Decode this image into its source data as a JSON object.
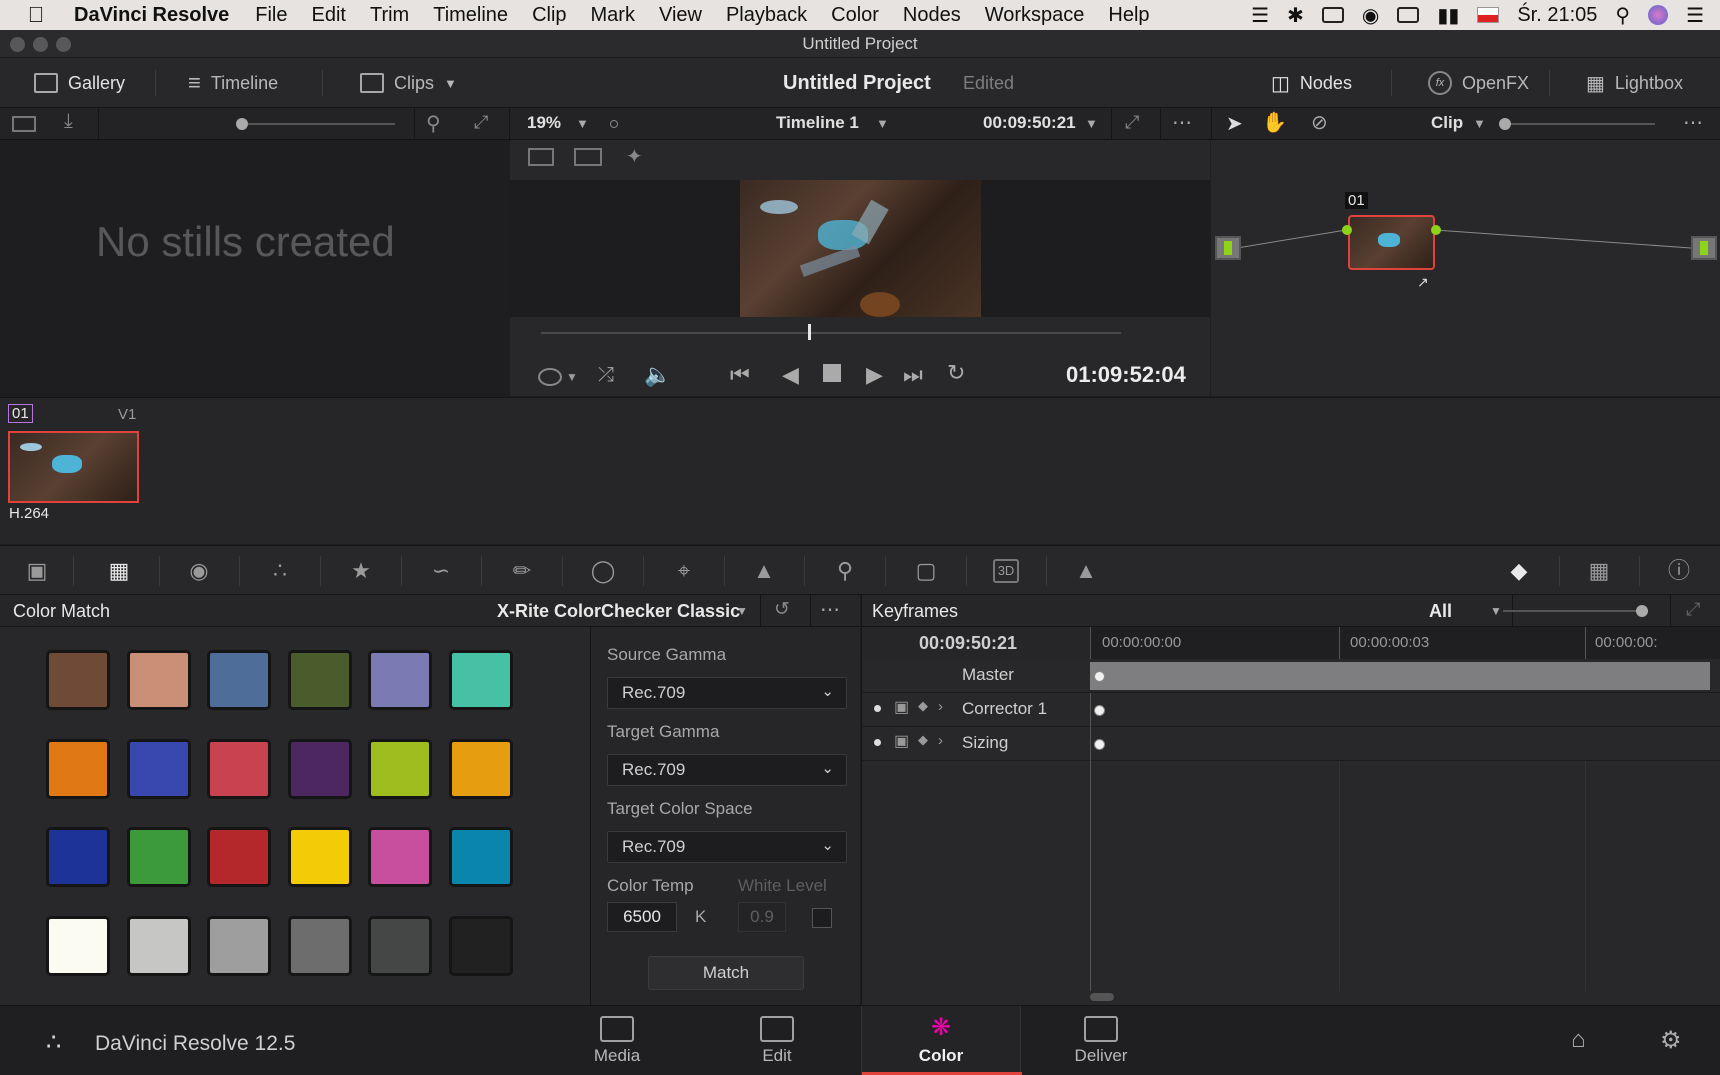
{
  "menubar": {
    "app_name": "DaVinci Resolve",
    "items": [
      "File",
      "Edit",
      "Trim",
      "Timeline",
      "Clip",
      "Mark",
      "View",
      "Playback",
      "Color",
      "Nodes",
      "Workspace",
      "Help"
    ],
    "clock": "Śr. 21:05"
  },
  "window": {
    "title": "Untitled Project"
  },
  "toolbar": {
    "gallery": "Gallery",
    "timeline": "Timeline",
    "clips": "Clips",
    "project_title": "Untitled Project",
    "project_status": "Edited",
    "nodes": "Nodes",
    "openfx": "OpenFX",
    "lightbox": "Lightbox"
  },
  "viewer_bar": {
    "zoom": "19%",
    "timeline_name": "Timeline 1",
    "timecode": "00:09:50:21",
    "mode": "Clip"
  },
  "gallery": {
    "empty_text": "No stills created"
  },
  "viewer": {
    "playhead_timecode": "01:09:52:04",
    "scrub_progress": 0.46
  },
  "nodes": {
    "node_label": "01"
  },
  "clip": {
    "number": "01",
    "track": "V1",
    "codec": "H.264"
  },
  "color_match": {
    "title": "Color Match",
    "chart": "X-Rite ColorChecker Classic",
    "swatches": [
      "#6f4a36",
      "#c98f77",
      "#4f6d99",
      "#4a5c2c",
      "#7b7ab3",
      "#47c1a5",
      "#e07913",
      "#3848ae",
      "#c8434f",
      "#4d275f",
      "#9fbd1f",
      "#e69e10",
      "#1e3398",
      "#3c9a3b",
      "#b4272b",
      "#f3cc07",
      "#c84f9d",
      "#0a86ad",
      "#fbfbf2",
      "#c6c7c4",
      "#9d9e9d",
      "#6c6d6c",
      "#454646",
      "#212121"
    ],
    "source_gamma_label": "Source Gamma",
    "source_gamma": "Rec.709",
    "target_gamma_label": "Target Gamma",
    "target_gamma": "Rec.709",
    "target_space_label": "Target Color Space",
    "target_space": "Rec.709",
    "color_temp_label": "Color Temp",
    "color_temp": "6500",
    "temp_unit": "K",
    "white_level_label": "White Level",
    "white_level": "0.9",
    "match_button": "Match"
  },
  "keyframes": {
    "title": "Keyframes",
    "filter": "All",
    "current_tc": "00:09:50:21",
    "ruler": [
      "00:00:00:00",
      "00:00:00:03",
      "00:00:00:"
    ],
    "rows": [
      "Master",
      "Corrector 1",
      "Sizing"
    ]
  },
  "pagebar": {
    "app_version": "DaVinci Resolve 12.5",
    "pages": [
      "Media",
      "Edit",
      "Color",
      "Deliver"
    ],
    "active_page": "Color"
  }
}
